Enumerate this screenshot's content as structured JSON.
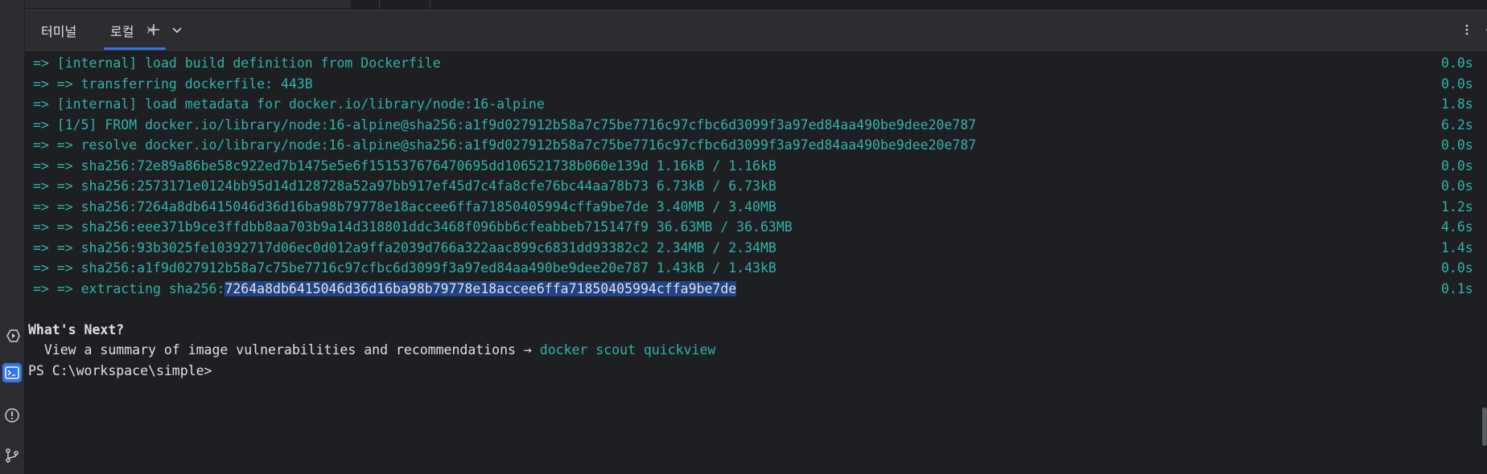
{
  "tabs": [
    {
      "label": "터미널"
    },
    {
      "label": "로컬",
      "active": true
    }
  ],
  "icons": {
    "new_tab": "plus-icon",
    "dropdown": "chevron-down-icon",
    "options": "more-vertical-icon",
    "minimize": "minimize-icon",
    "run": "run-services-icon",
    "terminal": "terminal-icon",
    "problems": "problems-icon",
    "git": "git-icon"
  },
  "colors": {
    "accent": "#3574f0",
    "terminal_text": "#2fb3aa",
    "selection": "#214283"
  },
  "build_lines": [
    {
      "text": "=> [internal] load build definition from Dockerfile",
      "time": "0.0s"
    },
    {
      "text": "=> => transferring dockerfile: 443B",
      "time": "0.0s"
    },
    {
      "text": "=> [internal] load metadata for docker.io/library/node:16-alpine",
      "time": "1.8s"
    },
    {
      "text": "=> [1/5] FROM docker.io/library/node:16-alpine@sha256:a1f9d027912b58a7c75be7716c97cfbc6d3099f3a97ed84aa490be9dee20e787",
      "time": "6.2s"
    },
    {
      "text": "=> => resolve docker.io/library/node:16-alpine@sha256:a1f9d027912b58a7c75be7716c97cfbc6d3099f3a97ed84aa490be9dee20e787",
      "time": "0.0s"
    },
    {
      "text": "=> => sha256:72e89a86be58c922ed7b1475e5e6f151537676470695dd106521738b060e139d 1.16kB / 1.16kB",
      "time": "0.0s"
    },
    {
      "text": "=> => sha256:2573171e0124bb95d14d128728a52a97bb917ef45d7c4fa8cfe76bc44aa78b73 6.73kB / 6.73kB",
      "time": "0.0s"
    },
    {
      "text": "=> => sha256:7264a8db6415046d36d16ba98b79778e18accee6ffa71850405994cffa9be7de 3.40MB / 3.40MB",
      "time": "1.2s"
    },
    {
      "text": "=> => sha256:eee371b9ce3ffdbb8aa703b9a14d318801ddc3468f096bb6cfeabbeb715147f9 36.63MB / 36.63MB",
      "time": "4.6s"
    },
    {
      "text": "=> => sha256:93b3025fe10392717d06ec0d012a9ffa2039d766a322aac899c6831dd93382c2 2.34MB / 2.34MB",
      "time": "1.4s"
    },
    {
      "text": "=> => sha256:a1f9d027912b58a7c75be7716c97cfbc6d3099f3a97ed84aa490be9dee20e787 1.43kB / 1.43kB",
      "time": "0.0s"
    }
  ],
  "extract_line": {
    "prefix": "=> => extracting sha256:",
    "selected": "7264a8db6415046d36d16ba98b79778e18accee6ffa71850405994cffa9be7de",
    "time": "0.1s"
  },
  "whats_next": {
    "heading": "What's Next?",
    "text": "  View a summary of image vulnerabilities and recommendations → ",
    "command": "docker scout quickview"
  },
  "prompt": "PS C:\\workspace\\simple>"
}
